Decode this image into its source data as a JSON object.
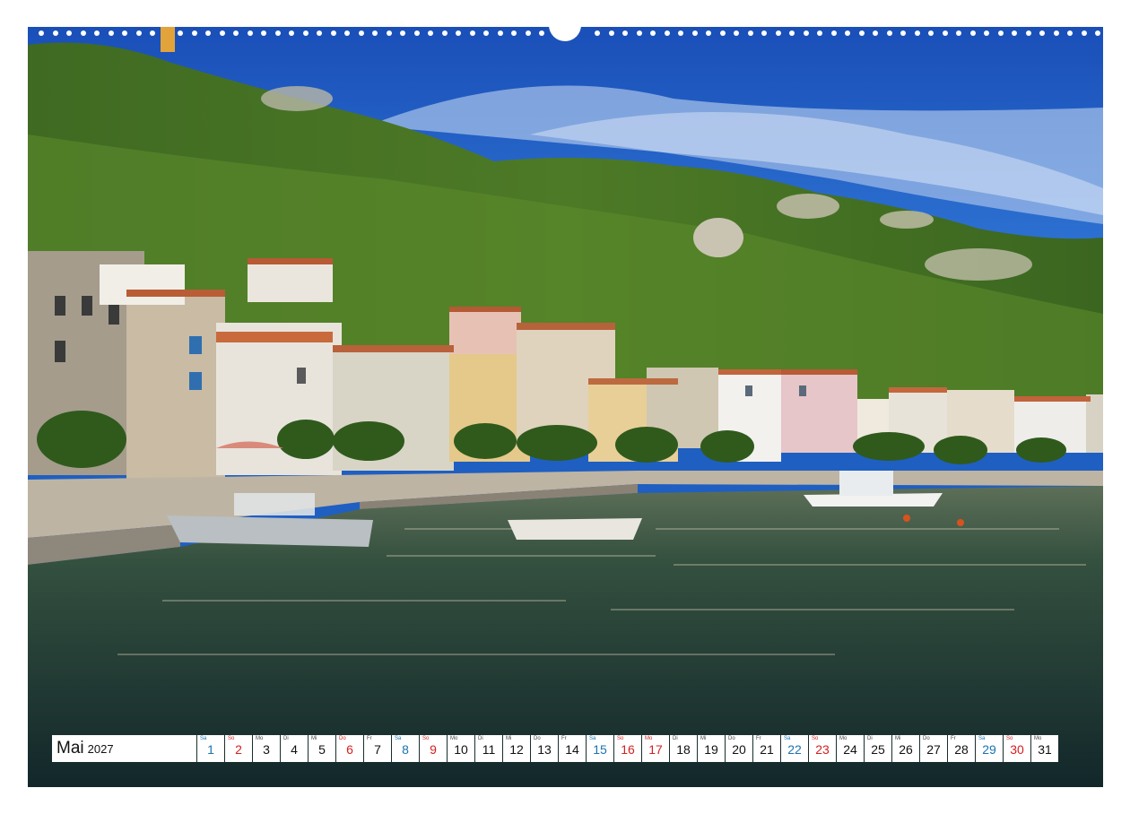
{
  "calendar": {
    "month": "Mai",
    "year": "2027",
    "days": [
      {
        "dow": "Sa",
        "num": "1",
        "kind": "sat"
      },
      {
        "dow": "So",
        "num": "2",
        "kind": "sun"
      },
      {
        "dow": "Mo",
        "num": "3",
        "kind": "wd"
      },
      {
        "dow": "Di",
        "num": "4",
        "kind": "wd"
      },
      {
        "dow": "Mi",
        "num": "5",
        "kind": "wd"
      },
      {
        "dow": "Do",
        "num": "6",
        "kind": "hol"
      },
      {
        "dow": "Fr",
        "num": "7",
        "kind": "wd"
      },
      {
        "dow": "Sa",
        "num": "8",
        "kind": "sat"
      },
      {
        "dow": "So",
        "num": "9",
        "kind": "sun"
      },
      {
        "dow": "Mo",
        "num": "10",
        "kind": "wd"
      },
      {
        "dow": "Di",
        "num": "11",
        "kind": "wd"
      },
      {
        "dow": "Mi",
        "num": "12",
        "kind": "wd"
      },
      {
        "dow": "Do",
        "num": "13",
        "kind": "wd"
      },
      {
        "dow": "Fr",
        "num": "14",
        "kind": "wd"
      },
      {
        "dow": "Sa",
        "num": "15",
        "kind": "sat"
      },
      {
        "dow": "So",
        "num": "16",
        "kind": "sun"
      },
      {
        "dow": "Mo",
        "num": "17",
        "kind": "hol"
      },
      {
        "dow": "Di",
        "num": "18",
        "kind": "wd"
      },
      {
        "dow": "Mi",
        "num": "19",
        "kind": "wd"
      },
      {
        "dow": "Do",
        "num": "20",
        "kind": "wd"
      },
      {
        "dow": "Fr",
        "num": "21",
        "kind": "wd"
      },
      {
        "dow": "Sa",
        "num": "22",
        "kind": "sat"
      },
      {
        "dow": "So",
        "num": "23",
        "kind": "sun"
      },
      {
        "dow": "Mo",
        "num": "24",
        "kind": "wd"
      },
      {
        "dow": "Di",
        "num": "25",
        "kind": "wd"
      },
      {
        "dow": "Mi",
        "num": "26",
        "kind": "wd"
      },
      {
        "dow": "Do",
        "num": "27",
        "kind": "wd"
      },
      {
        "dow": "Fr",
        "num": "28",
        "kind": "wd"
      },
      {
        "dow": "Sa",
        "num": "29",
        "kind": "sat"
      },
      {
        "dow": "So",
        "num": "30",
        "kind": "sun"
      },
      {
        "dow": "Mo",
        "num": "31",
        "kind": "wd"
      }
    ]
  },
  "colors": {
    "saturday": "#1a73b0",
    "sunday_holiday": "#d42020",
    "sky": "#1f5fc2",
    "sea": "#1d3a30",
    "tab": "#e2a33a"
  }
}
